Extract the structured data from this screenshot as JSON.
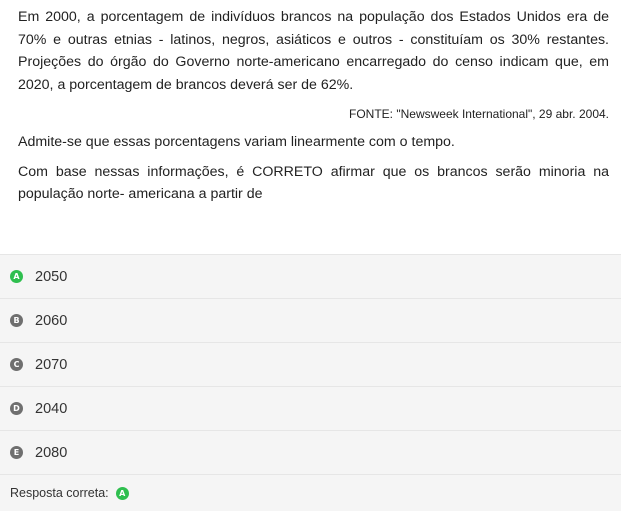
{
  "question": {
    "paragraph1": "Em 2000, a porcentagem de indivíduos brancos na população dos Estados Unidos era de 70% e outras etnias - latinos, negros, asiáticos e outros - constituíam os 30% restantes. Projeções do órgão do Governo norte-americano encarregado do censo indicam que, em 2020, a porcentagem de brancos deverá ser de 62%.",
    "source": "FONTE: \"Newsweek International\", 29 abr. 2004.",
    "paragraph2": "Admite-se que essas porcentagens variam linearmente com o tempo.",
    "paragraph3": "Com base nessas informações, é CORRETO afirmar que os brancos serão minoria na população norte- americana a partir de"
  },
  "options": [
    {
      "letter": "A",
      "text": "2050",
      "correct": true
    },
    {
      "letter": "B",
      "text": "2060",
      "correct": false
    },
    {
      "letter": "C",
      "text": "2070",
      "correct": false
    },
    {
      "letter": "D",
      "text": "2040",
      "correct": false
    },
    {
      "letter": "E",
      "text": "2080",
      "correct": false
    }
  ],
  "answer": {
    "label": "Resposta correta:",
    "letter": "A"
  },
  "colors": {
    "correct_badge": "#2fbf4f",
    "neutral_badge": "#6f6f6f",
    "options_background": "#f5f5f5"
  }
}
